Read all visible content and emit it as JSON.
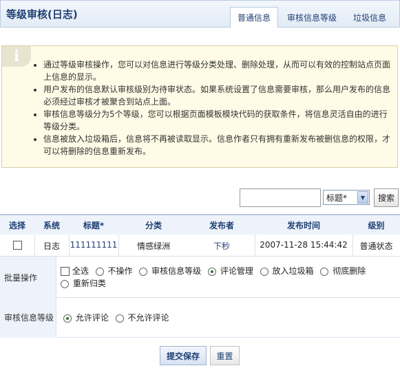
{
  "header": {
    "title": "等级审核(日志)",
    "tabs": [
      {
        "label": "普通信息",
        "active": true
      },
      {
        "label": "审核信息等级",
        "active": false
      },
      {
        "label": "垃圾信息",
        "active": false
      }
    ]
  },
  "info": {
    "icon": "info-icon",
    "items": [
      "通过等级审核操作，您可以对信息进行等级分类处理、删除处理，从而可以有效的控制站点页面上信息的显示。",
      "用户发布的信息默认审核级别为待审状态。如果系统设置了信息需要审核，那么用户发布的信息必须经过审核才被聚合到站点上面。",
      "审核信息等级分为5个等级，您可以根据页面模板模块代码的获取条件，将信息灵活自由的进行等级分类。",
      "信息被放入垃圾箱后，信息将不再被读取显示。信息作者只有拥有重新发布被删信息的权限，才可以将删除的信息重新发布。"
    ]
  },
  "search": {
    "input_value": "",
    "select_value": "标题*",
    "button_label": "搜索"
  },
  "table": {
    "headers": [
      "选择",
      "系统",
      "标题*",
      "分类",
      "发布者",
      "发布时间",
      "级别"
    ],
    "rows": [
      {
        "system": "日志",
        "title": "111111111",
        "category": "情感绿洲",
        "author": "下秒",
        "time": "2007-11-28 15:44:42",
        "level": "普通状态"
      }
    ]
  },
  "batch": {
    "label": "批量操作",
    "select_all": "全选",
    "options": [
      "不操作",
      "审核信息等级",
      "评论管理",
      "放入垃圾箱",
      "彻底删除",
      "重新归类"
    ],
    "selected": "评论管理"
  },
  "level": {
    "label": "审核信息等级",
    "options": [
      "允许评论",
      "不允许评论"
    ],
    "selected": "允许评论"
  },
  "buttons": {
    "submit": "提交保存",
    "reset": "重置"
  },
  "colors": {
    "accent": "#1f3f73",
    "header_bg": "#e2ebf6",
    "info_bg": "#fffbe6"
  }
}
